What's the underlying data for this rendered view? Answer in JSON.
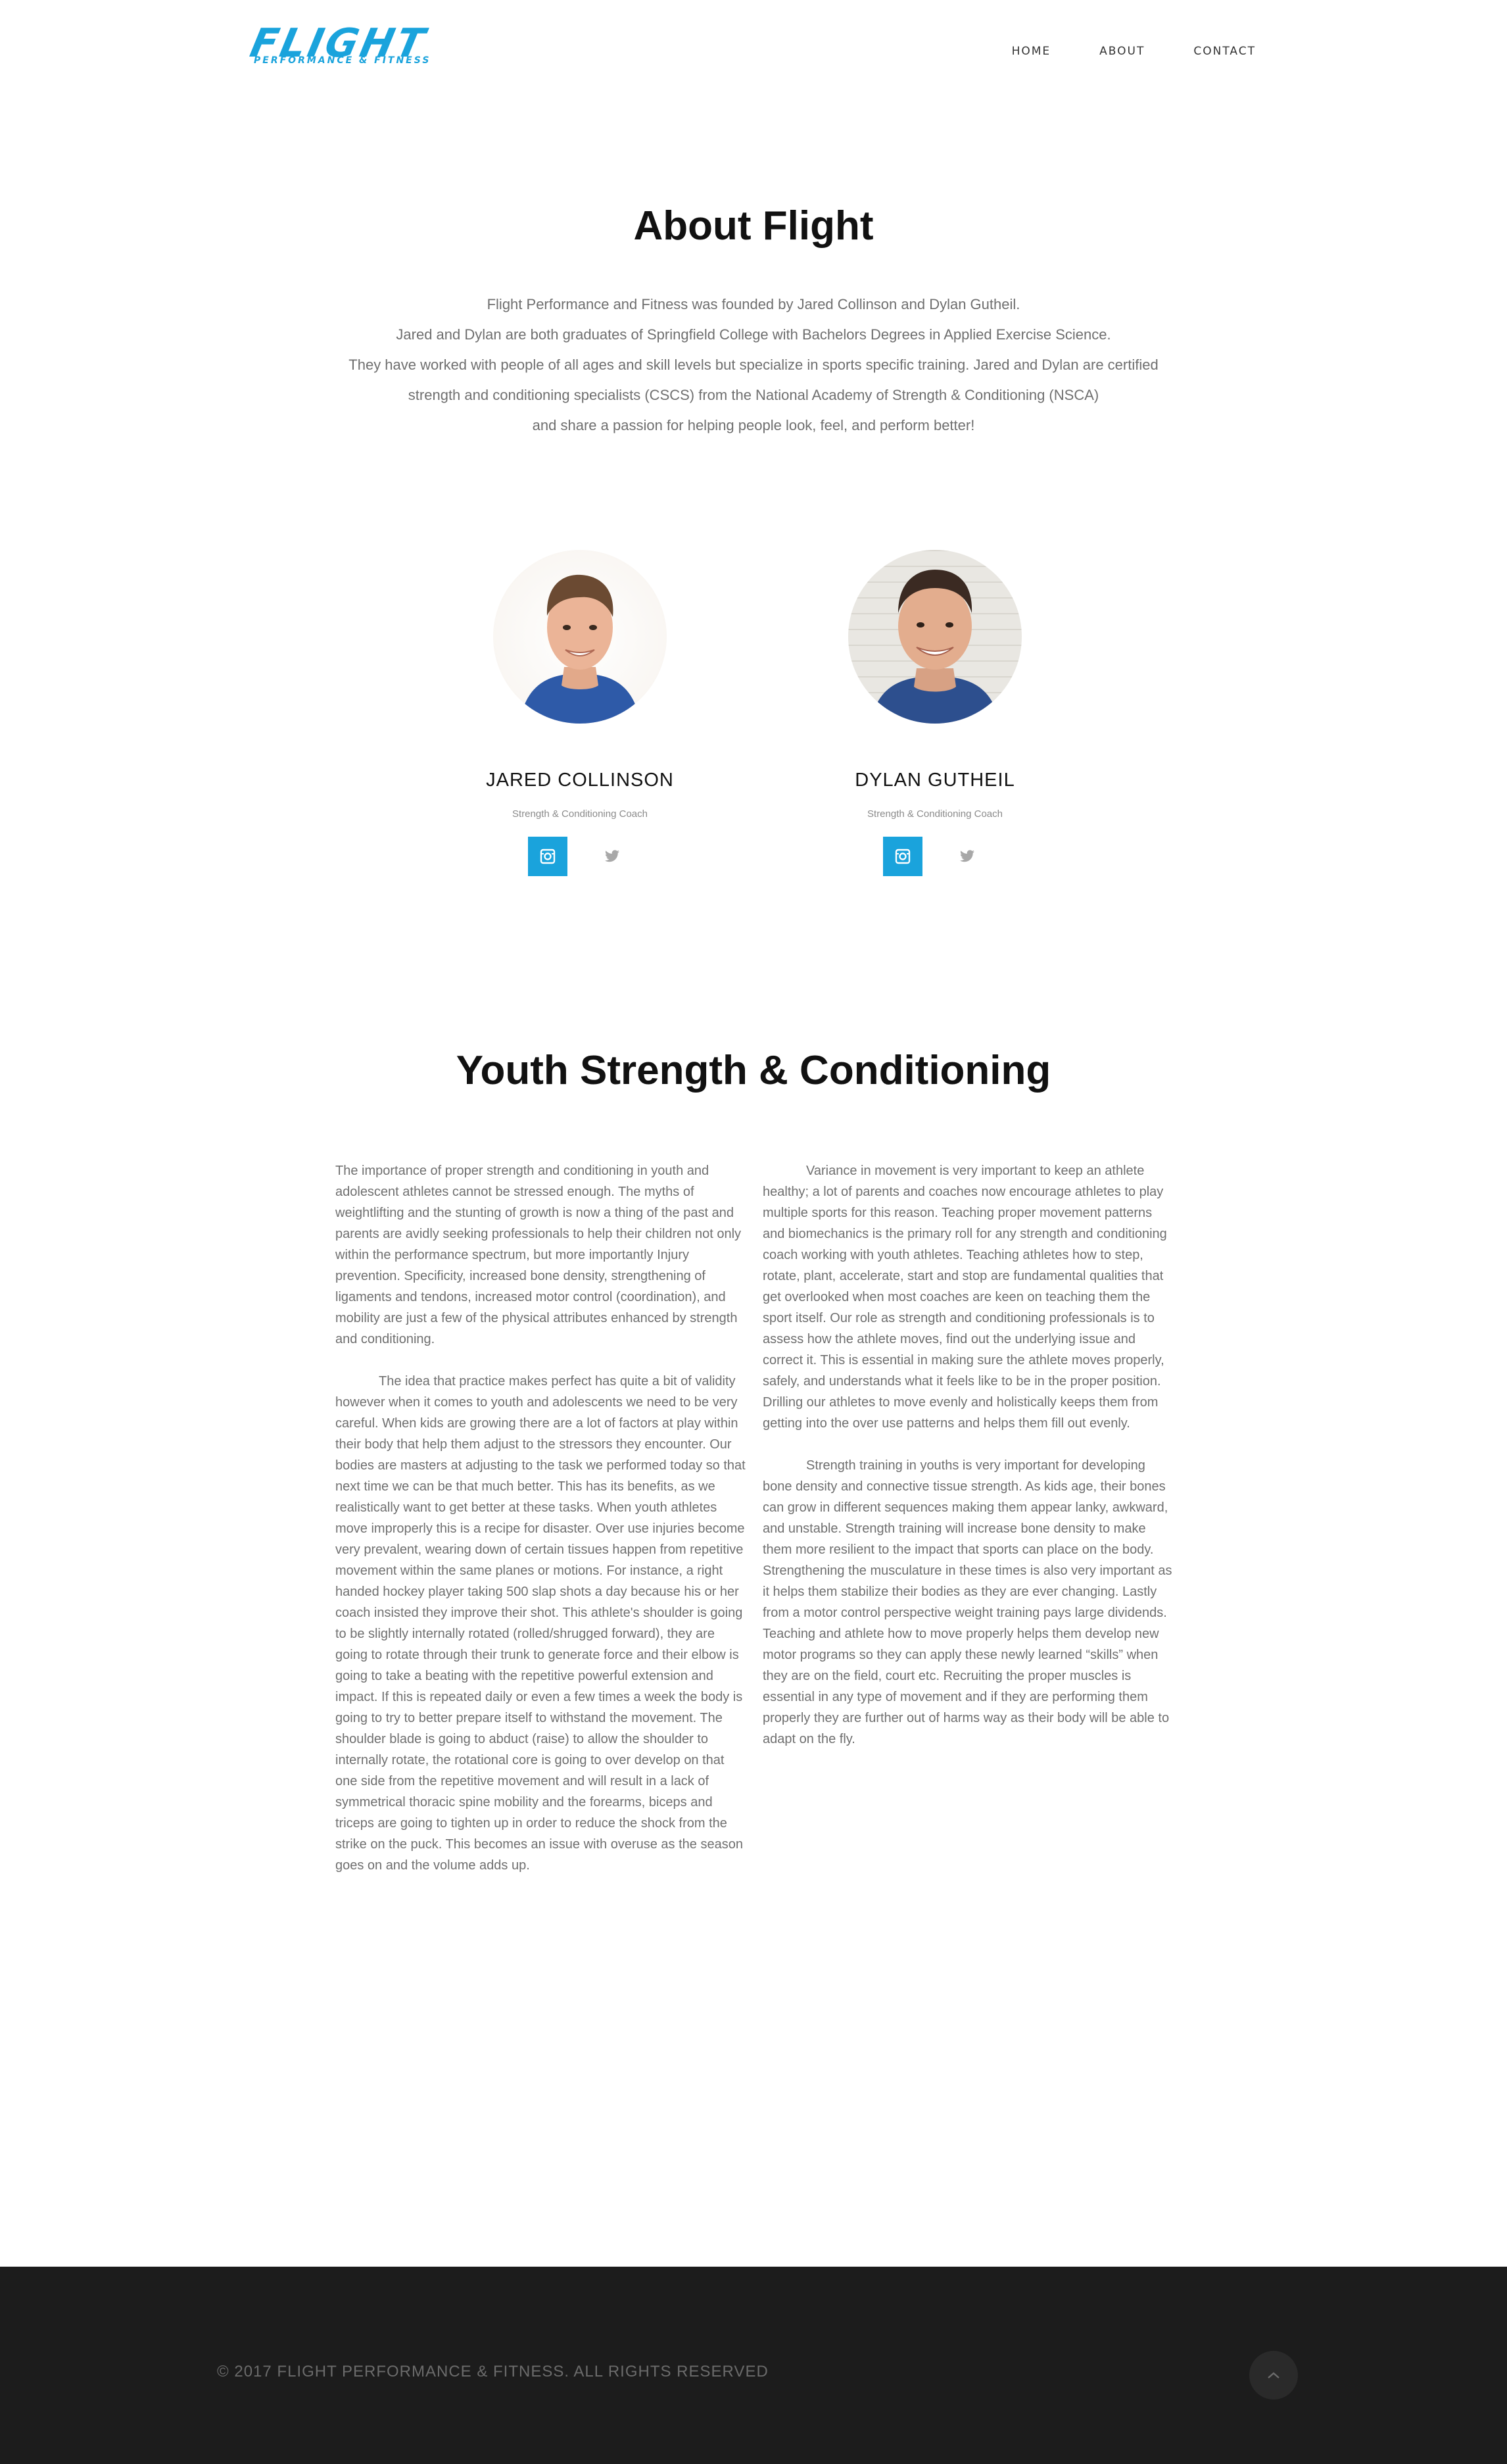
{
  "header": {
    "logo_main": "FLIGHT",
    "logo_sub": "PERFORMANCE & FITNESS",
    "nav": [
      {
        "label": "HOME"
      },
      {
        "label": "ABOUT"
      },
      {
        "label": "CONTACT"
      }
    ]
  },
  "about": {
    "title": "About Flight",
    "lines": [
      "Flight Performance and Fitness was founded by Jared Collinson and Dylan Gutheil.",
      "Jared and Dylan are both graduates of Springfield College with Bachelors Degrees in Applied Exercise Science.",
      "They have worked with people of all ages and skill levels but specialize in sports specific training.  Jared and Dylan are certified",
      "strength and conditioning specialists (CSCS) from the National Academy of Strength & Conditioning (NSCA)",
      "and share a passion for helping people look, feel, and perform better!"
    ]
  },
  "team": [
    {
      "name": "JARED COLLINSON",
      "role": "Strength & Conditioning Coach",
      "social": [
        "instagram-icon",
        "twitter-icon"
      ]
    },
    {
      "name": "DYLAN GUTHEIL",
      "role": "Strength & Conditioning Coach",
      "social": [
        "instagram-icon",
        "twitter-icon"
      ]
    }
  ],
  "youth": {
    "title": "Youth Strength & Conditioning",
    "col1": [
      "The importance of proper strength and conditioning in youth and adolescent athletes cannot be stressed enough.  The myths of weightlifting and the stunting of growth is now a thing of the past and parents are avidly seeking professionals to help their children not only within the performance spectrum, but more importantly Injury prevention.  Specificity, increased bone density, strengthening of ligaments and tendons, increased motor control (coordination), and mobility are just a few of the physical attributes enhanced by strength and conditioning.",
      "The idea that practice makes perfect has quite a bit of validity however when it comes to youth and adolescents we need to be very careful.  When kids are growing there are a lot of factors at play within their body that help them adjust to the stressors they encounter.  Our bodies are masters at adjusting to the task we performed today so that next time we can be that much better.  This has its benefits, as we realistically want to get better at these tasks.  When youth athletes move improperly this is a recipe for disaster.  Over use injuries become very prevalent, wearing down of certain tissues happen from repetitive movement within the same planes or motions.  For instance, a right handed hockey player taking 500 slap shots a day because his or her coach insisted they improve their shot.  This athlete's shoulder is going to be slightly internally rotated (rolled/shrugged forward), they are going to rotate through their trunk to generate force and their elbow is going to take a beating with the repetitive powerful extension and impact.  If this is repeated daily or even a few times a week the body is going to try to better prepare itself to withstand the movement.  The shoulder blade is going to abduct (raise) to allow the shoulder to internally rotate, the rotational core is going to over develop on that one side from the repetitive movement and will result in a lack of symmetrical thoracic spine mobility and the forearms, biceps and triceps are going to tighten up in order to reduce the shock from the strike on the puck.  This becomes an issue with overuse as the season goes on and the volume adds up."
    ],
    "col2": [
      "Variance in movement is very important to keep an athlete healthy; a lot of parents and coaches now encourage athletes to play multiple sports for this reason.  Teaching proper movement patterns and biomechanics is the primary roll for any strength and conditioning coach working with youth athletes.  Teaching athletes how to step, rotate, plant, accelerate, start and stop are fundamental qualities that get overlooked when most coaches are keen on teaching them the sport itself.  Our role as strength and conditioning professionals is to assess how the athlete moves, find out the underlying issue and correct it.  This is essential in making sure the athlete moves properly, safely, and understands what it feels like to be in the proper position.  Drilling our athletes to move evenly and holistically keeps them from getting into the over use patterns and helps them fill out evenly.",
      "Strength training in youths is very important for developing bone density and connective tissue strength.  As kids age, their bones can grow in different sequences making them appear lanky, awkward, and unstable.  Strength training will increase bone density to make them more resilient to the impact that sports can place on the body.  Strengthening the musculature in these times is also very important as it helps them stabilize their bodies as they are ever changing.  Lastly from a motor control perspective weight training pays large dividends.  Teaching and athlete how to move properly helps them develop new motor programs so they can apply these newly learned “skills” when they are on the field, court etc.  Recruiting the proper muscles is essential in any type of movement and if they are performing them properly they are further out of harms way as their body will be able to adapt on the fly."
    ]
  },
  "footer": {
    "copyright": "© 2017 FLIGHT PERFORMANCE & FITNESS. ALL RIGHTS RESERVED",
    "to_top_icon": "chevron-up-icon"
  },
  "colors": {
    "accent": "#1aa3dc",
    "footer_bg": "#1c1c1c",
    "body_text": "#6f6f6f"
  }
}
